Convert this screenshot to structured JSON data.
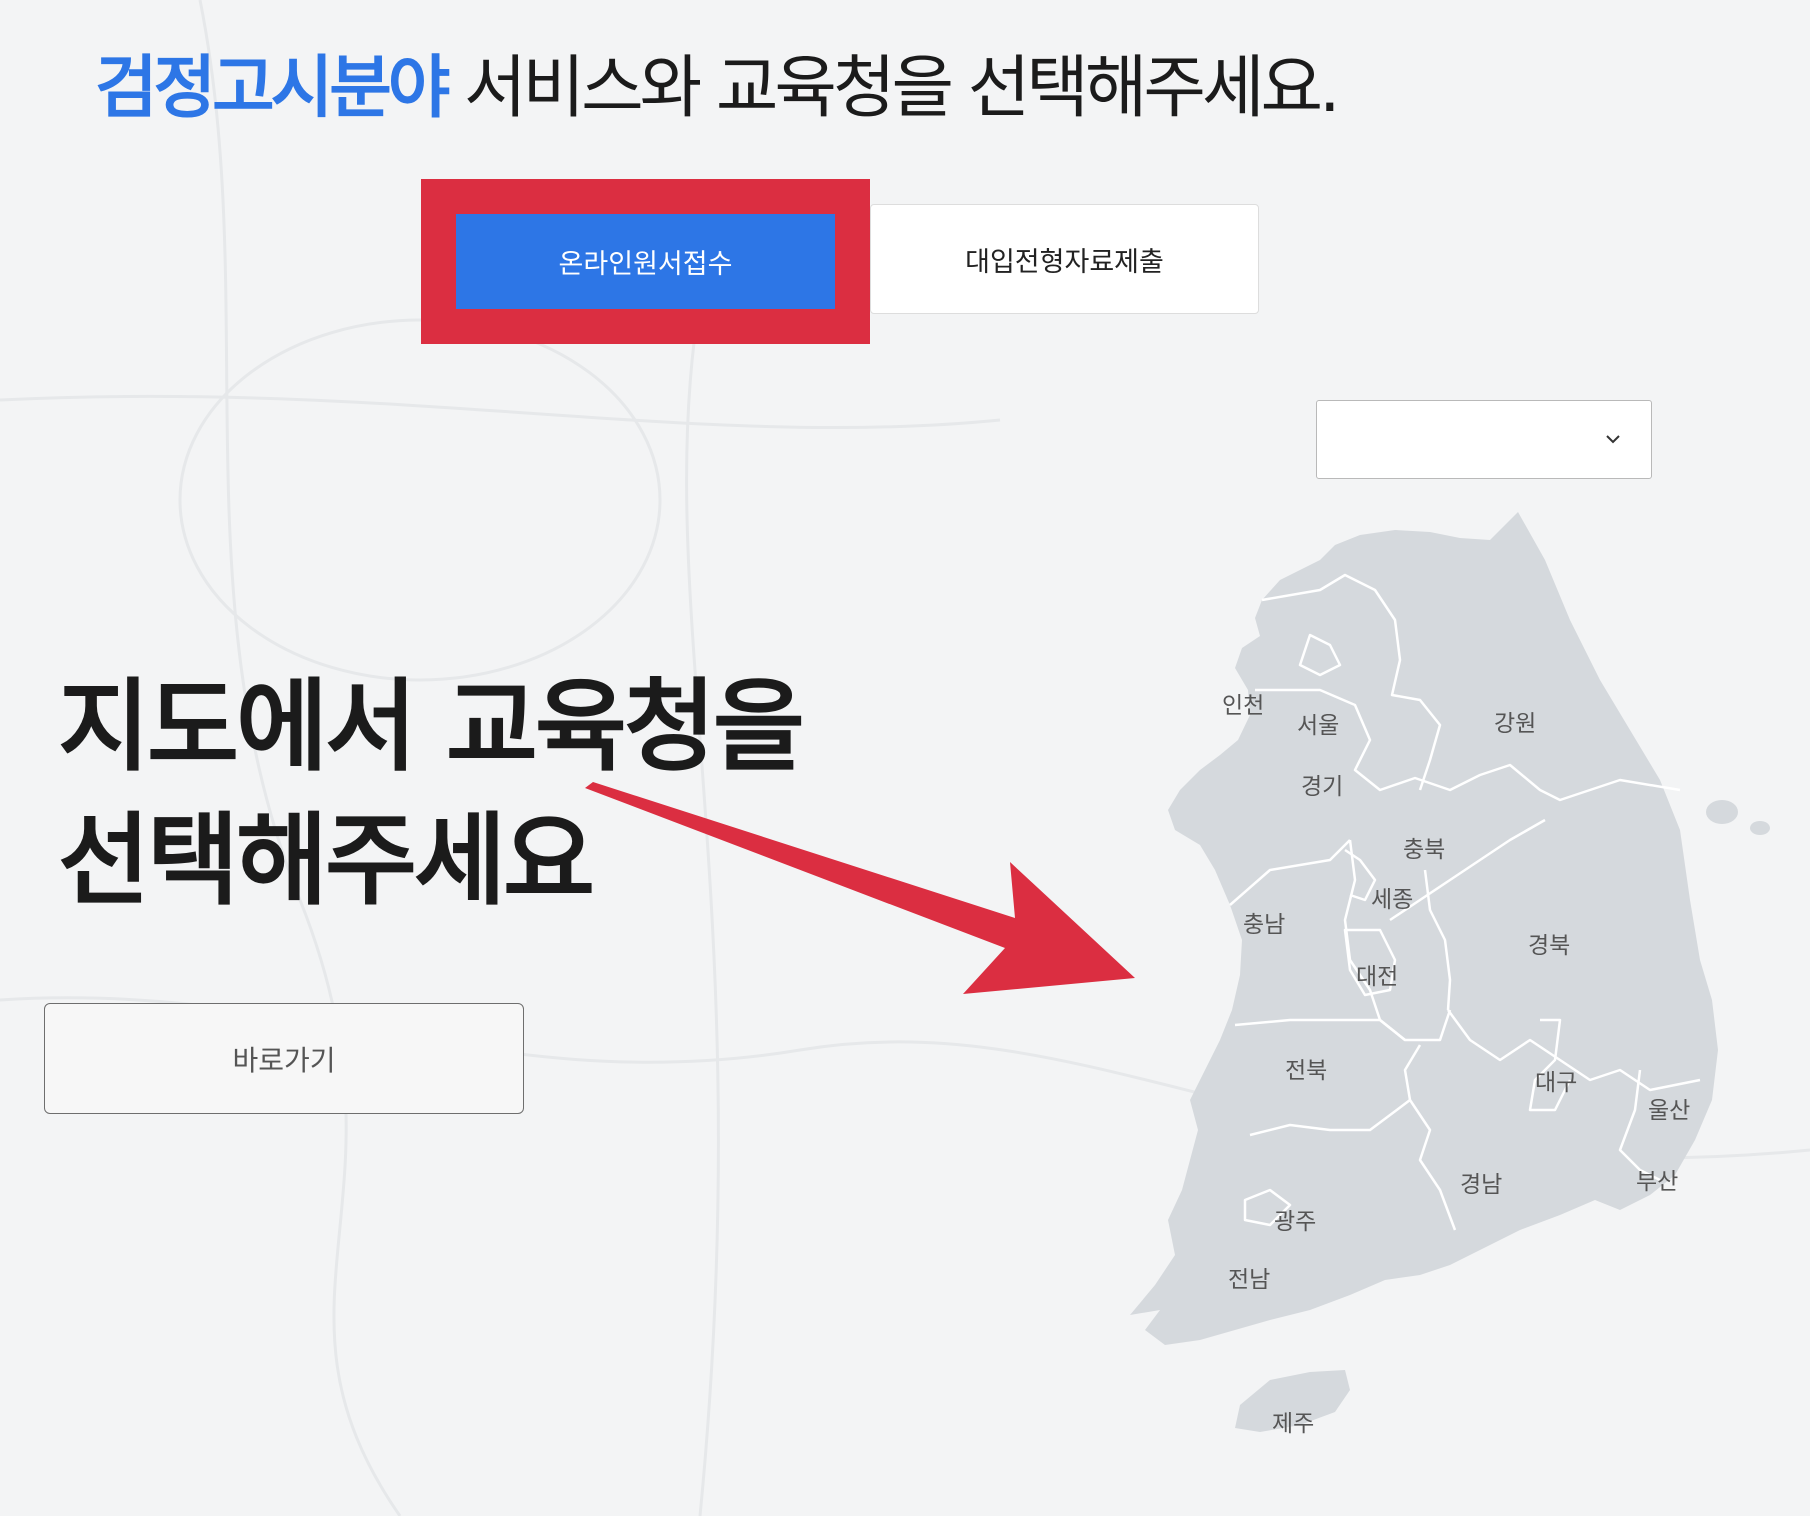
{
  "header": {
    "title_accent": "검정고시분야",
    "title_rest": " 서비스와 교육청을 선택해주세요."
  },
  "tabs": [
    {
      "label": "온라인원서접수",
      "selected": true
    },
    {
      "label": "대입전형자료제출",
      "selected": false
    }
  ],
  "region_select": {
    "value": "",
    "icon": "chevron-down-icon"
  },
  "map_section": {
    "heading_line1": "지도에서 교육청을",
    "heading_line2": "선택해주세요",
    "go_button": "바로가기"
  },
  "map": {
    "regions": {
      "incheon": "인천",
      "seoul": "서울",
      "gyeonggi": "경기",
      "gangwon": "강원",
      "chungbuk": "충북",
      "sejong": "세종",
      "chungnam": "충남",
      "daejeon": "대전",
      "gyeongbuk": "경북",
      "jeonbuk": "전북",
      "daegu": "대구",
      "ulsan": "울산",
      "gyeongnam": "경남",
      "busan": "부산",
      "gwangju": "광주",
      "jeonnam": "전남",
      "jeju": "제주"
    }
  },
  "colors": {
    "accent": "#2d76e6",
    "highlight": "#db2e41",
    "map_fill": "#d5d9dd"
  }
}
